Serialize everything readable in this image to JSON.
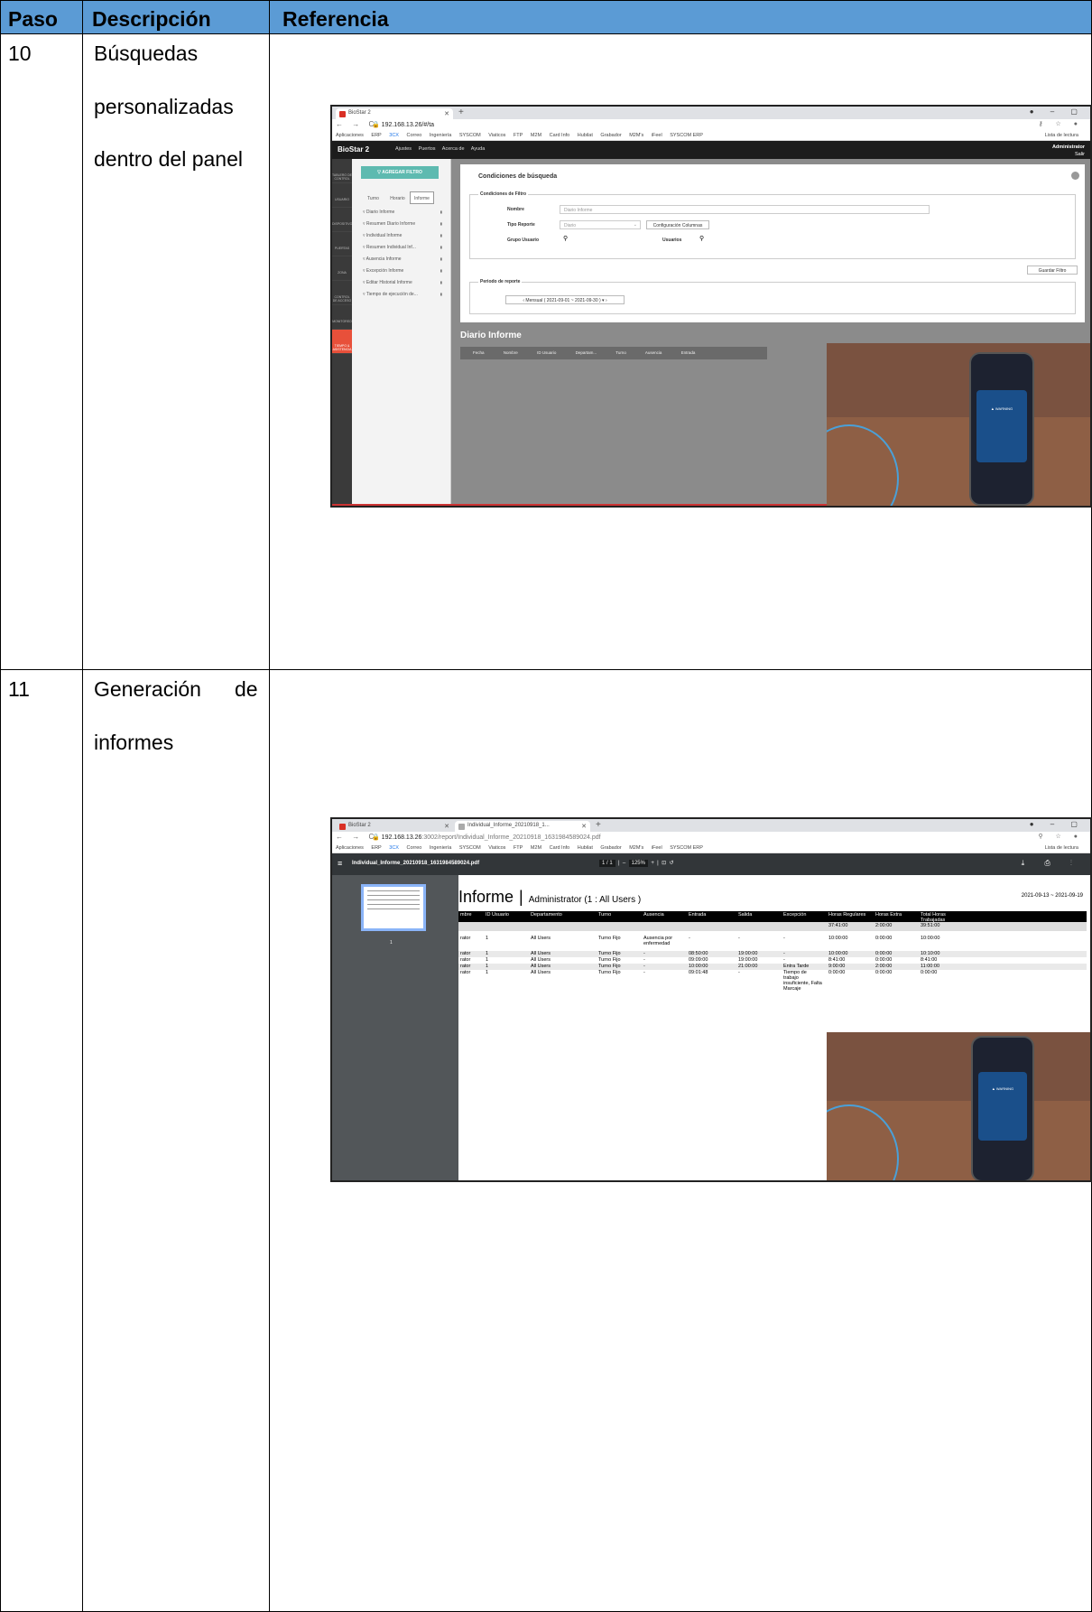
{
  "table": {
    "headers": {
      "paso": "Paso",
      "descripcion": "Descripción",
      "referencia": "Referencia"
    },
    "rows": [
      {
        "paso": "10",
        "descripcion_lines": [
          "Búsquedas",
          "personalizadas",
          "dentro del panel"
        ]
      },
      {
        "paso": "11",
        "descripcion_lines": [
          "Generación",
          "de",
          "informes"
        ]
      }
    ]
  },
  "colors": {
    "header_bg": "#5b9bd5",
    "biostar_accent": "#5ebab0",
    "biostar_active": "#e8503a"
  },
  "shot1": {
    "tab_title": "BioStar 2",
    "url": "192.168.13.26/#/ta",
    "bookmarks": [
      "Aplicaciones",
      "ERP",
      "3CX",
      "Correo",
      "Ingeniería",
      "SYSCOM",
      "Viaticos",
      "FTP",
      "M2M",
      "Card Info",
      "Hubilat",
      "Grabador",
      "M2M's",
      "iFeel",
      "SYSCOM ERP"
    ],
    "reading_list": "Lista de lectura",
    "app_logo": "BioStar 2",
    "top_menu": [
      "Ajustes",
      "Puertos",
      "Acerca de",
      "Ayuda"
    ],
    "admin_name": "Administrator",
    "logout": "Salir",
    "side_items": [
      "TABLERO DE CONTROL",
      "USUARIO",
      "DISPOSITIVO",
      "PUERTAS",
      "ZONA",
      "CONTROL DE ACCESO",
      "MONITOREO",
      "TIEMPO & ASISTENCIA"
    ],
    "add_filter": "AGREGAR FILTRO",
    "tabs": [
      "Turno",
      "Horario",
      "Informe"
    ],
    "reports": [
      "Diario Informe",
      "Resumen Diario Informe",
      "Individual Informe",
      "Resumen Individual Inf...",
      "Ausencia Informe",
      "Excepción Informe",
      "Editar Historial Informe",
      "Tiempo de ejecución de..."
    ],
    "search_title": "Condiciones de búsqueda",
    "filter_title": "Condiciones de Filtro",
    "nombre_label": "Nombre",
    "nombre_value": "Diario Informe",
    "tipo_label": "Tipo Reporte",
    "tipo_value": "Diario",
    "config_columns": "Configuración Columnas",
    "grupo_label": "Grupo Usuario",
    "usuarios_label": "Usuarios",
    "save_filter": "Guardar Filtro",
    "periodo_title": "Periodo de reporte",
    "periodo_value": "Mensual ( 2021-09-01 ~ 2021-09-30 )",
    "report_title": "Diario Informe",
    "columns": [
      "Fecha",
      "Nombre",
      "ID Usuario",
      "Departam...",
      "Turno",
      "Ausencia",
      "Entrada"
    ]
  },
  "shot2": {
    "tab1_title": "BioStar 2",
    "tab2_title": "Individual_Informe_20210918_1...",
    "url_host": "192.168.13.26",
    "url_path": ":3002/report/Individual_Informe_20210918_1631984589024.pdf",
    "bookmarks": [
      "Aplicaciones",
      "ERP",
      "3CX",
      "Correo",
      "Ingeniería",
      "SYSCOM",
      "Viaticos",
      "FTP",
      "M2M",
      "Card Info",
      "Hubilat",
      "Grabador",
      "M2M's",
      "iFeel",
      "SYSCOM ERP"
    ],
    "reading_list": "Lista de lectura",
    "pdf_name": "Individual_Informe_20210918_1631984589024.pdf",
    "page_indicator": "1 / 1",
    "zoom": "125%",
    "thumb_page": "1",
    "doc_title": "Informe",
    "doc_subtitle": "Administrator (1 : All Users )",
    "date_range": "2021-09-13 ~ 2021-09-19",
    "columns": [
      "mbre",
      "ID Usuario",
      "Departamento",
      "Turno",
      "Ausencia",
      "Entrada",
      "Salida",
      "Excepción",
      "Horas Regulares",
      "Horas Extra",
      "Total Horas Trabajadas"
    ],
    "totals": [
      "37:41:00",
      "2:00:00",
      "39:51:00"
    ],
    "rows": [
      [
        "rator",
        "1",
        "All Users",
        "Turno Fijo",
        "Ausencia por enfermedad",
        "-",
        "-",
        "-",
        "10:00:00",
        "0:00:00",
        "10:00:00"
      ],
      [
        "rator",
        "1",
        "All Users",
        "Turno Fijo",
        "-",
        "08:50:00",
        "19:00:00",
        "-",
        "10:00:00",
        "0:00:00",
        "10:10:00"
      ],
      [
        "rator",
        "1",
        "All Users",
        "Turno Fijo",
        "-",
        "09:09:00",
        "19:00:00",
        "-",
        "8:41:00",
        "0:00:00",
        "8:41:00"
      ],
      [
        "rator",
        "1",
        "All Users",
        "Turno Fijo",
        "-",
        "10:00:00",
        "21:00:00",
        "Entra Tarde",
        "9:00:00",
        "2:00:00",
        "11:00:00"
      ],
      [
        "rator",
        "1",
        "All Users",
        "Turno Fijo",
        "-",
        "09:01:48",
        "-",
        "Tiempo de trabajo insuficiente, Falta Marcaje",
        "0:00:00",
        "0:00:00",
        "0:00:00"
      ]
    ]
  }
}
